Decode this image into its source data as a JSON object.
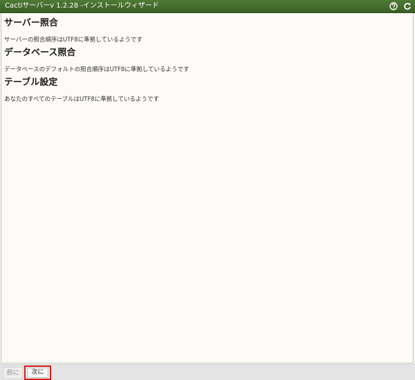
{
  "window": {
    "title": "Cactiサーバーv 1.2.28 -インストールウィザード",
    "icons": [
      "help-icon",
      "refresh-icon"
    ]
  },
  "sections": [
    {
      "heading": "サーバー照合",
      "text": "サーバーの照合順序はUTF8に準拠しているようです"
    },
    {
      "heading": "データベース照合",
      "text": "データベースのデフォルトの照合順序はUTF8に準拠しているようです"
    },
    {
      "heading": "テーブル設定",
      "text": "あなたのすべてのテーブルはUTF8に準拠しているようです"
    }
  ],
  "footer": {
    "prev_label": "前に",
    "next_label": "次に"
  },
  "colors": {
    "titlebar": "#3f6629",
    "content_bg": "#fdfaf8",
    "highlight": "#d91a1a"
  }
}
